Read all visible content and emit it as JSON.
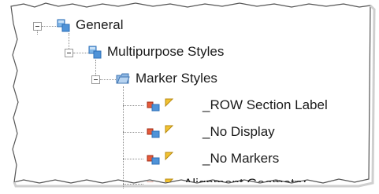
{
  "tree": {
    "nodes": [
      {
        "label": "General",
        "icon": "style-group-icon"
      },
      {
        "label": "Multipurpose Styles",
        "icon": "style-group-icon"
      },
      {
        "label": "Marker Styles",
        "icon": "folder-icon"
      },
      {
        "label": "_ROW Section Label",
        "icon": "marker-style-icon"
      },
      {
        "label": "_No Display",
        "icon": "marker-style-icon"
      },
      {
        "label": "_No Markers",
        "icon": "marker-style-icon"
      },
      {
        "label": "Alignment Geometry",
        "icon": "marker-style-icon"
      }
    ]
  }
}
